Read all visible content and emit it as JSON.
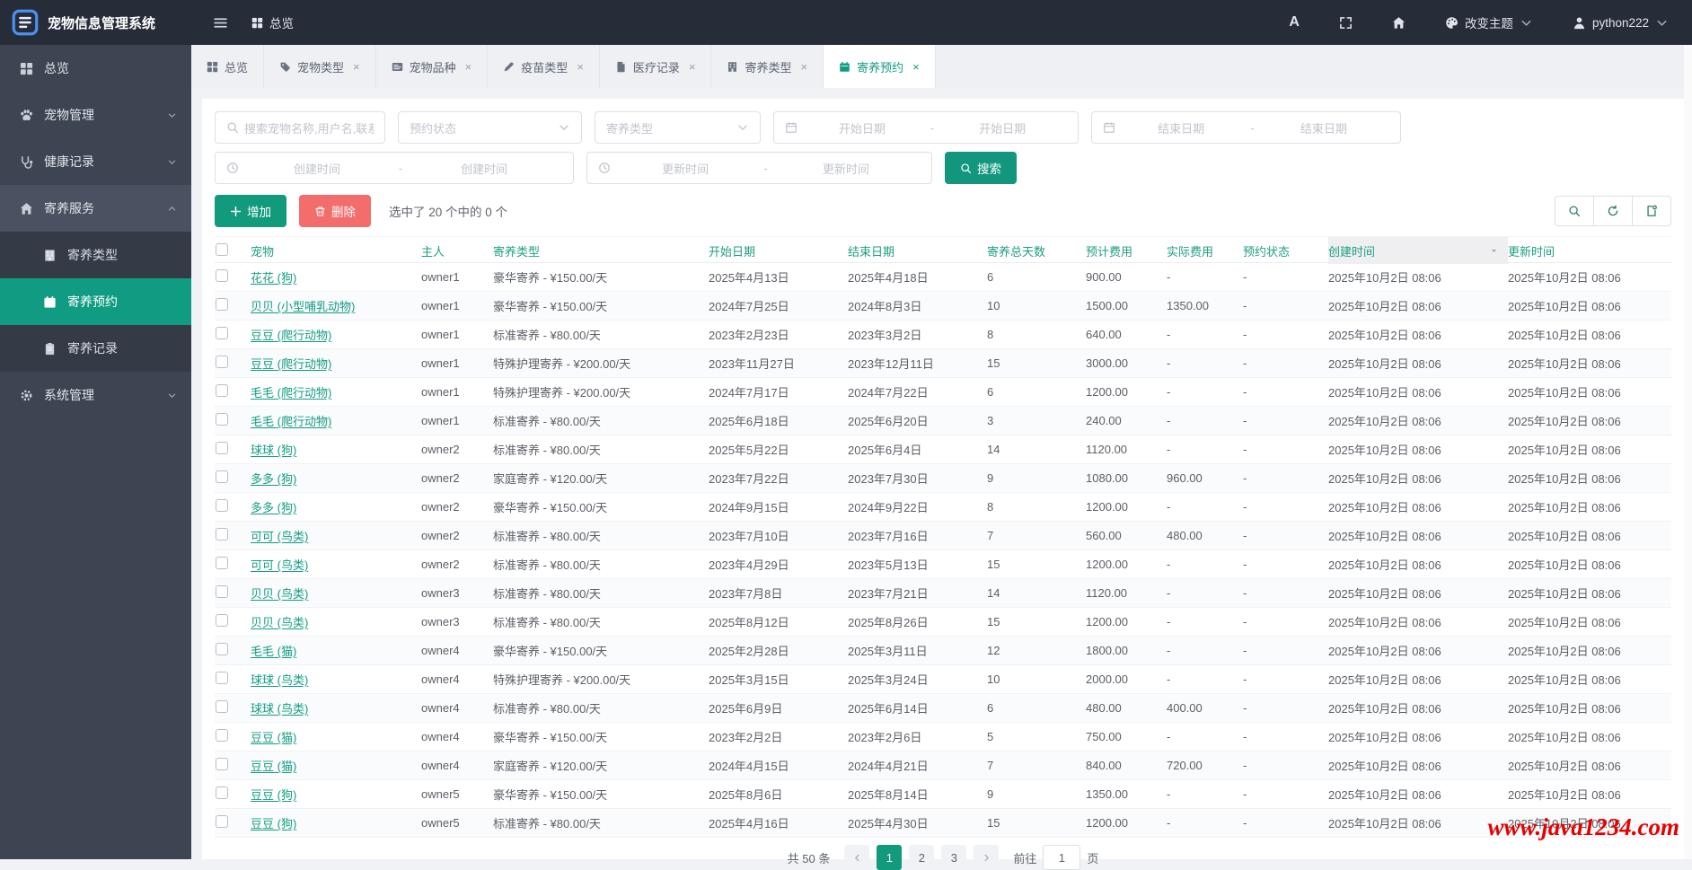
{
  "app": {
    "title": "宠物信息管理系统"
  },
  "navbar": {
    "hamburger_icon": "hamburger-icon",
    "breadcrumb": "总览",
    "font_button_label": "A",
    "icons": [
      "fullscreen-icon",
      "home-icon",
      "palette-icon",
      "user-icon"
    ],
    "theme_label": "改变主题",
    "username": "python222"
  },
  "sidebar": {
    "items": [
      {
        "label": "总览",
        "icon": "grid-icon",
        "expandable": false
      },
      {
        "label": "宠物管理",
        "icon": "paw-icon",
        "expandable": true
      },
      {
        "label": "健康记录",
        "icon": "stethoscope-icon",
        "expandable": true
      },
      {
        "label": "寄养服务",
        "icon": "home-icon",
        "expandable": true,
        "expanded": true
      },
      {
        "label": "系统管理",
        "icon": "gear-icon",
        "expandable": true
      }
    ],
    "boarding_children": [
      {
        "label": "寄养类型",
        "icon": "building-icon",
        "active": false
      },
      {
        "label": "寄养预约",
        "icon": "calendar-icon",
        "active": true
      },
      {
        "label": "寄养记录",
        "icon": "clipboard-icon",
        "active": false
      }
    ]
  },
  "tabs": [
    {
      "label": "总览",
      "icon": "grid-icon",
      "closable": false,
      "active": false
    },
    {
      "label": "宠物类型",
      "icon": "tag-icon",
      "closable": true,
      "active": false
    },
    {
      "label": "宠物品种",
      "icon": "card-icon",
      "closable": true,
      "active": false
    },
    {
      "label": "疫苗类型",
      "icon": "syringe-icon",
      "closable": true,
      "active": false
    },
    {
      "label": "医疗记录",
      "icon": "file-icon",
      "closable": true,
      "active": false
    },
    {
      "label": "寄养类型",
      "icon": "building-icon",
      "closable": true,
      "active": false
    },
    {
      "label": "寄养预约",
      "icon": "calendar-icon",
      "closable": true,
      "active": true
    }
  ],
  "close_glyph": "×",
  "filters": {
    "search_placeholder": "搜索宠物名称,用户名,联系",
    "status_placeholder": "预约状态",
    "type_placeholder": "寄养类型",
    "start_date_placeholder": "开始日期",
    "end_date_placeholder": "结束日期",
    "create_time_placeholder": "创建时间",
    "update_time_placeholder": "更新时间",
    "range_separator": "-",
    "search_button_label": "搜索"
  },
  "toolbar": {
    "add_label": "增加",
    "delete_label": "删除",
    "selection_text": "选中了 20 个中的 0 个"
  },
  "table": {
    "columns": [
      "宠物",
      "主人",
      "寄养类型",
      "开始日期",
      "结束日期",
      "寄养总天数",
      "预计费用",
      "实际费用",
      "预约状态",
      "创建时间",
      "更新时间"
    ],
    "sorted_column": "创建时间",
    "rows": [
      {
        "pet": "花花 (狗)",
        "owner": "owner1",
        "type": "豪华寄养 - ¥150.00/天",
        "start": "2025年4月13日",
        "end": "2025年4月18日",
        "days": "6",
        "est": "900.00",
        "actual": "-",
        "status": "-",
        "created": "2025年10月2日 08:06",
        "updated": "2025年10月2日 08:06"
      },
      {
        "pet": "贝贝 (小型哺乳动物)",
        "owner": "owner1",
        "type": "豪华寄养 - ¥150.00/天",
        "start": "2024年7月25日",
        "end": "2024年8月3日",
        "days": "10",
        "est": "1500.00",
        "actual": "1350.00",
        "status": "-",
        "created": "2025年10月2日 08:06",
        "updated": "2025年10月2日 08:06"
      },
      {
        "pet": "豆豆 (爬行动物)",
        "owner": "owner1",
        "type": "标准寄养 - ¥80.00/天",
        "start": "2023年2月23日",
        "end": "2023年3月2日",
        "days": "8",
        "est": "640.00",
        "actual": "-",
        "status": "-",
        "created": "2025年10月2日 08:06",
        "updated": "2025年10月2日 08:06"
      },
      {
        "pet": "豆豆 (爬行动物)",
        "owner": "owner1",
        "type": "特殊护理寄养 - ¥200.00/天",
        "start": "2023年11月27日",
        "end": "2023年12月11日",
        "days": "15",
        "est": "3000.00",
        "actual": "-",
        "status": "-",
        "created": "2025年10月2日 08:06",
        "updated": "2025年10月2日 08:06"
      },
      {
        "pet": "毛毛 (爬行动物)",
        "owner": "owner1",
        "type": "特殊护理寄养 - ¥200.00/天",
        "start": "2024年7月17日",
        "end": "2024年7月22日",
        "days": "6",
        "est": "1200.00",
        "actual": "-",
        "status": "-",
        "created": "2025年10月2日 08:06",
        "updated": "2025年10月2日 08:06"
      },
      {
        "pet": "毛毛 (爬行动物)",
        "owner": "owner1",
        "type": "标准寄养 - ¥80.00/天",
        "start": "2025年6月18日",
        "end": "2025年6月20日",
        "days": "3",
        "est": "240.00",
        "actual": "-",
        "status": "-",
        "created": "2025年10月2日 08:06",
        "updated": "2025年10月2日 08:06"
      },
      {
        "pet": "球球 (狗)",
        "owner": "owner2",
        "type": "标准寄养 - ¥80.00/天",
        "start": "2025年5月22日",
        "end": "2025年6月4日",
        "days": "14",
        "est": "1120.00",
        "actual": "-",
        "status": "-",
        "created": "2025年10月2日 08:06",
        "updated": "2025年10月2日 08:06"
      },
      {
        "pet": "多多 (狗)",
        "owner": "owner2",
        "type": "家庭寄养 - ¥120.00/天",
        "start": "2023年7月22日",
        "end": "2023年7月30日",
        "days": "9",
        "est": "1080.00",
        "actual": "960.00",
        "status": "-",
        "created": "2025年10月2日 08:06",
        "updated": "2025年10月2日 08:06"
      },
      {
        "pet": "多多 (狗)",
        "owner": "owner2",
        "type": "豪华寄养 - ¥150.00/天",
        "start": "2024年9月15日",
        "end": "2024年9月22日",
        "days": "8",
        "est": "1200.00",
        "actual": "-",
        "status": "-",
        "created": "2025年10月2日 08:06",
        "updated": "2025年10月2日 08:06"
      },
      {
        "pet": "可可 (鸟类)",
        "owner": "owner2",
        "type": "标准寄养 - ¥80.00/天",
        "start": "2023年7月10日",
        "end": "2023年7月16日",
        "days": "7",
        "est": "560.00",
        "actual": "480.00",
        "status": "-",
        "created": "2025年10月2日 08:06",
        "updated": "2025年10月2日 08:06"
      },
      {
        "pet": "可可 (鸟类)",
        "owner": "owner2",
        "type": "标准寄养 - ¥80.00/天",
        "start": "2023年4月29日",
        "end": "2023年5月13日",
        "days": "15",
        "est": "1200.00",
        "actual": "-",
        "status": "-",
        "created": "2025年10月2日 08:06",
        "updated": "2025年10月2日 08:06"
      },
      {
        "pet": "贝贝 (鸟类)",
        "owner": "owner3",
        "type": "标准寄养 - ¥80.00/天",
        "start": "2023年7月8日",
        "end": "2023年7月21日",
        "days": "14",
        "est": "1120.00",
        "actual": "-",
        "status": "-",
        "created": "2025年10月2日 08:06",
        "updated": "2025年10月2日 08:06"
      },
      {
        "pet": "贝贝 (鸟类)",
        "owner": "owner3",
        "type": "标准寄养 - ¥80.00/天",
        "start": "2025年8月12日",
        "end": "2025年8月26日",
        "days": "15",
        "est": "1200.00",
        "actual": "-",
        "status": "-",
        "created": "2025年10月2日 08:06",
        "updated": "2025年10月2日 08:06"
      },
      {
        "pet": "毛毛 (猫)",
        "owner": "owner4",
        "type": "豪华寄养 - ¥150.00/天",
        "start": "2025年2月28日",
        "end": "2025年3月11日",
        "days": "12",
        "est": "1800.00",
        "actual": "-",
        "status": "-",
        "created": "2025年10月2日 08:06",
        "updated": "2025年10月2日 08:06"
      },
      {
        "pet": "球球 (鸟类)",
        "owner": "owner4",
        "type": "特殊护理寄养 - ¥200.00/天",
        "start": "2025年3月15日",
        "end": "2025年3月24日",
        "days": "10",
        "est": "2000.00",
        "actual": "-",
        "status": "-",
        "created": "2025年10月2日 08:06",
        "updated": "2025年10月2日 08:06"
      },
      {
        "pet": "球球 (鸟类)",
        "owner": "owner4",
        "type": "标准寄养 - ¥80.00/天",
        "start": "2025年6月9日",
        "end": "2025年6月14日",
        "days": "6",
        "est": "480.00",
        "actual": "400.00",
        "status": "-",
        "created": "2025年10月2日 08:06",
        "updated": "2025年10月2日 08:06"
      },
      {
        "pet": "豆豆 (猫)",
        "owner": "owner4",
        "type": "豪华寄养 - ¥150.00/天",
        "start": "2023年2月2日",
        "end": "2023年2月6日",
        "days": "5",
        "est": "750.00",
        "actual": "-",
        "status": "-",
        "created": "2025年10月2日 08:06",
        "updated": "2025年10月2日 08:06"
      },
      {
        "pet": "豆豆 (猫)",
        "owner": "owner4",
        "type": "家庭寄养 - ¥120.00/天",
        "start": "2024年4月15日",
        "end": "2024年4月21日",
        "days": "7",
        "est": "840.00",
        "actual": "720.00",
        "status": "-",
        "created": "2025年10月2日 08:06",
        "updated": "2025年10月2日 08:06"
      },
      {
        "pet": "豆豆 (狗)",
        "owner": "owner5",
        "type": "豪华寄养 - ¥150.00/天",
        "start": "2025年8月6日",
        "end": "2025年8月14日",
        "days": "9",
        "est": "1350.00",
        "actual": "-",
        "status": "-",
        "created": "2025年10月2日 08:06",
        "updated": "2025年10月2日 08:06"
      },
      {
        "pet": "豆豆 (狗)",
        "owner": "owner5",
        "type": "标准寄养 - ¥80.00/天",
        "start": "2025年4月16日",
        "end": "2025年4月30日",
        "days": "15",
        "est": "1200.00",
        "actual": "-",
        "status": "-",
        "created": "2025年10月2日 08:06",
        "updated": "2025年10月2日 08:06"
      }
    ]
  },
  "pagination": {
    "total_text": "共 50 条",
    "pages": [
      "1",
      "2",
      "3"
    ],
    "active_page": "1",
    "goto_label": "前往",
    "goto_value": "1",
    "page_unit": "页"
  },
  "watermark": "www.java1234.com",
  "colors": {
    "primary": "#129a7d",
    "danger": "#f36d6d",
    "navbar": "#262c38",
    "sidebar": "#3e4552",
    "active_menu": "#109c82"
  }
}
